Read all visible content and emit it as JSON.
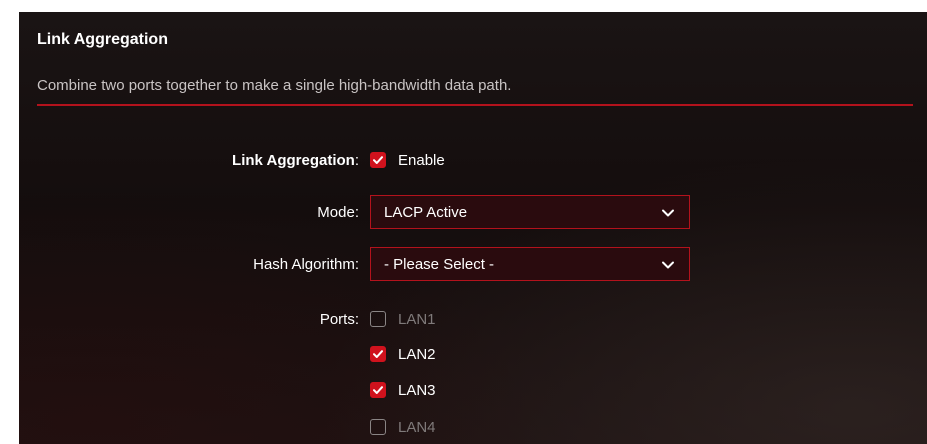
{
  "section": {
    "title": "Link Aggregation",
    "description": "Combine two ports together to make a single high-bandwidth data path."
  },
  "form": {
    "link_aggregation": {
      "label": "Link Aggregation",
      "colon": ":",
      "option_label": "Enable",
      "checked": true
    },
    "mode": {
      "label": "Mode:",
      "value": "LACP Active"
    },
    "hash_algorithm": {
      "label": "Hash Algorithm:",
      "value": "- Please Select -"
    },
    "ports": {
      "label": "Ports:",
      "items": [
        {
          "label": "LAN1",
          "checked": false,
          "disabled": true
        },
        {
          "label": "LAN2",
          "checked": true,
          "disabled": false
        },
        {
          "label": "LAN3",
          "checked": true,
          "disabled": false
        },
        {
          "label": "LAN4",
          "checked": false,
          "disabled": true
        }
      ]
    }
  },
  "colors": {
    "accent": "#d0121d",
    "divider": "#b3121c",
    "background": "#160f0f"
  },
  "icons": {
    "check": "check-icon",
    "dropdown": "chevron-down-icon"
  }
}
